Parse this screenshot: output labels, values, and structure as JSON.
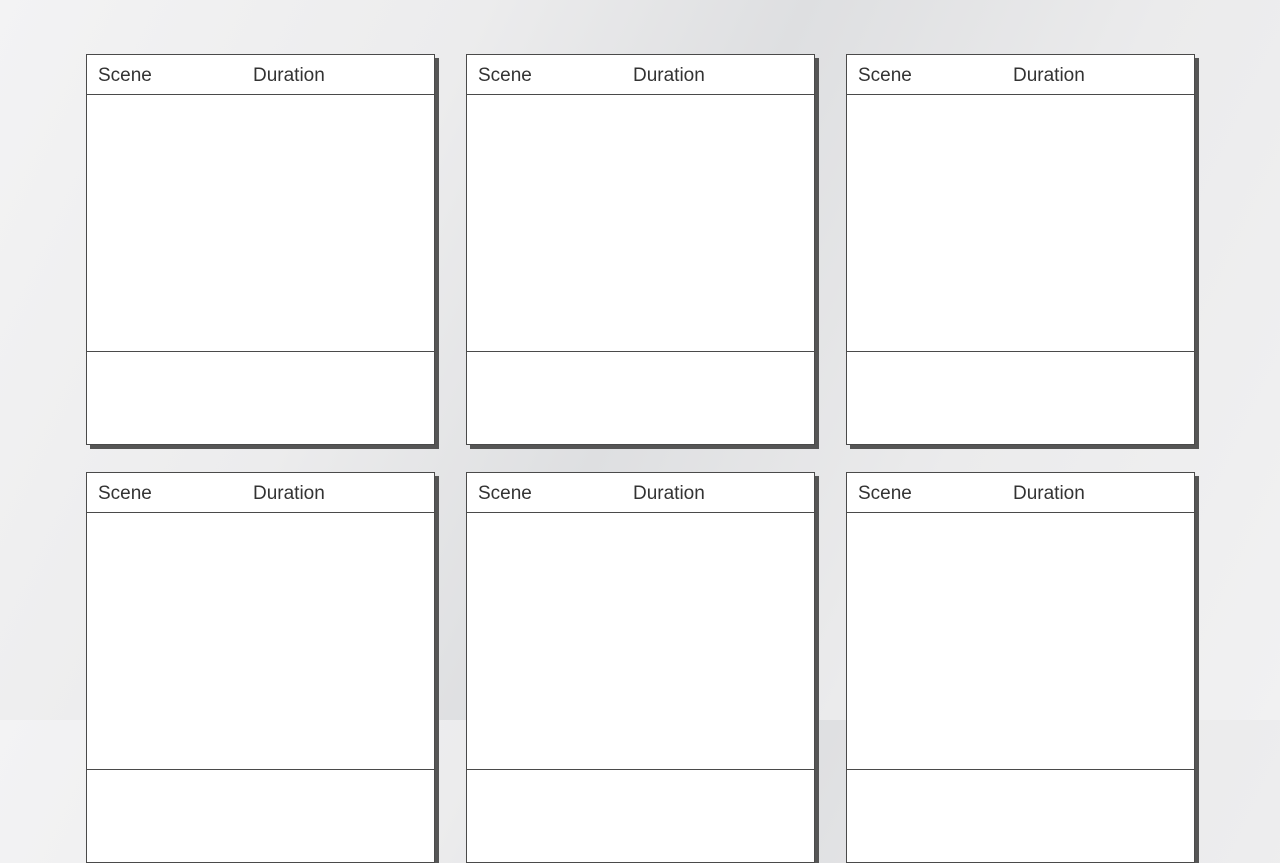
{
  "storyboard": {
    "panels": [
      {
        "scene_label": "Scene",
        "duration_label": "Duration"
      },
      {
        "scene_label": "Scene",
        "duration_label": "Duration"
      },
      {
        "scene_label": "Scene",
        "duration_label": "Duration"
      },
      {
        "scene_label": "Scene",
        "duration_label": "Duration"
      },
      {
        "scene_label": "Scene",
        "duration_label": "Duration"
      },
      {
        "scene_label": "Scene",
        "duration_label": "Duration"
      }
    ]
  },
  "colors": {
    "frame_border": "#4a4a4a",
    "frame_shadow": "#555555",
    "frame_fill": "#ffffff",
    "label_text": "#333333",
    "background_light": "#f3f3f4",
    "background_dark": "#dedfe1"
  }
}
